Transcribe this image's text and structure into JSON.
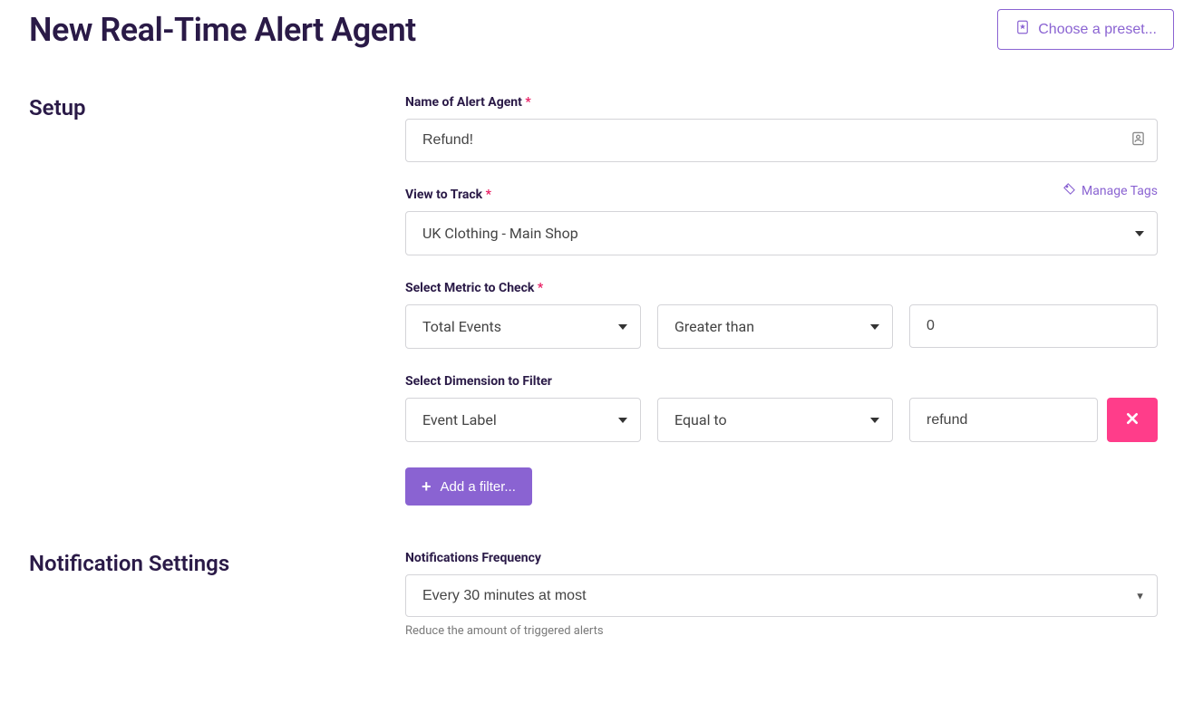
{
  "header": {
    "title": "New Real-Time Alert Agent",
    "preset_button": "Choose a preset..."
  },
  "setup": {
    "section_title": "Setup",
    "name_label": "Name of Alert Agent",
    "name_value": "Refund!",
    "manage_tags": "Manage Tags",
    "view_label": "View to Track",
    "view_value": "UK Clothing - Main Shop",
    "metric_label": "Select Metric to Check",
    "metric_value": "Total Events",
    "metric_operator": "Greater than",
    "metric_number": "0",
    "dimension_label": "Select Dimension to Filter",
    "dimension_field": "Event Label",
    "dimension_operator": "Equal to",
    "dimension_value": "refund",
    "add_filter_button": "Add a filter..."
  },
  "notifications": {
    "section_title": "Notification Settings",
    "frequency_label": "Notifications Frequency",
    "frequency_value": "Every 30 minutes at most",
    "frequency_helper": "Reduce the amount of triggered alerts"
  }
}
